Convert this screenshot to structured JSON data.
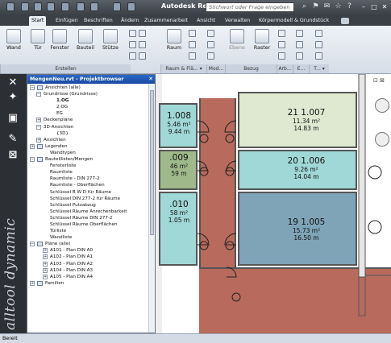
{
  "titlebar": {
    "app_title": "Autodesk Revit A...",
    "search_placeholder": "Stichwort oder Frage eingeben"
  },
  "tabs": [
    {
      "label": "Start",
      "active": true
    },
    {
      "label": "Einfügen"
    },
    {
      "label": "Beschriften"
    },
    {
      "label": "Ändern"
    },
    {
      "label": "Zusammenarbeit"
    },
    {
      "label": "Ansicht"
    },
    {
      "label": "Verwalten"
    },
    {
      "label": "Körpermodell & Grundstück"
    }
  ],
  "ribbon": {
    "buttons": [
      "Wand",
      "Tür",
      "Fenster",
      "Bauteil",
      "Stütze",
      "Raum",
      "Ebene",
      "Raster"
    ],
    "panels": [
      "Erstellen",
      "Raum & Flä... ▾",
      "Mod...",
      "Bezug",
      "Arb...",
      "E...",
      "T... ▾"
    ]
  },
  "browser": {
    "title": "MengenNeu.rvt - Projektbrowser",
    "close": "✕",
    "tree": [
      {
        "label": "Ansichten (alle)",
        "indent": 0,
        "exp": "−",
        "icon": "sq"
      },
      {
        "label": "Grundrisse (Grundrisse)",
        "indent": 1,
        "exp": "−"
      },
      {
        "label": "1.OG",
        "indent": 3,
        "bold": true
      },
      {
        "label": "2.OG",
        "indent": 3
      },
      {
        "label": "EG",
        "indent": 3
      },
      {
        "label": "Deckenpläne",
        "indent": 1,
        "exp": "+"
      },
      {
        "label": "3D-Ansichten",
        "indent": 1,
        "exp": "−"
      },
      {
        "label": "{3D}",
        "indent": 3
      },
      {
        "label": "Ansichten",
        "indent": 1,
        "exp": "+"
      },
      {
        "label": "Legenden",
        "indent": 0,
        "exp": "+",
        "icon": "sq"
      },
      {
        "label": "Wandtypen",
        "indent": 2
      },
      {
        "label": "Bauteillisten/Mengen",
        "indent": 0,
        "exp": "−",
        "icon": "sq"
      },
      {
        "label": "Fensterliste",
        "indent": 2
      },
      {
        "label": "Raumliste",
        "indent": 2
      },
      {
        "label": "Raumliste - DIN 277-2",
        "indent": 2
      },
      {
        "label": "Raumliste - Oberflächen",
        "indent": 2
      },
      {
        "label": "Schlüssel B W D für Räume",
        "indent": 2
      },
      {
        "label": "Schlüssel DIN 277-2 für Räume",
        "indent": 2
      },
      {
        "label": "Schlüssel Putzabzug",
        "indent": 2
      },
      {
        "label": "Schlüssel Räume Anrechenbarkeit",
        "indent": 2
      },
      {
        "label": "Schlüssel Räume DIN 277-2",
        "indent": 2
      },
      {
        "label": "Schlüssel Räume Oberflächen",
        "indent": 2
      },
      {
        "label": "Türliste",
        "indent": 2
      },
      {
        "label": "Wandliste",
        "indent": 2
      },
      {
        "label": "Pläne (alle)",
        "indent": 0,
        "exp": "−",
        "icon": "sq"
      },
      {
        "label": "A101 - Plan DIN A0",
        "indent": 2,
        "exp": "+"
      },
      {
        "label": "A102 - Plan DIN A1",
        "indent": 2,
        "exp": "+"
      },
      {
        "label": "A103 - Plan DIN A2",
        "indent": 2,
        "exp": "+"
      },
      {
        "label": "A104 - Plan DIN A3",
        "indent": 2,
        "exp": "+"
      },
      {
        "label": "A105 - Plan DIN A4",
        "indent": 2,
        "exp": "+"
      },
      {
        "label": "Familien",
        "indent": 0,
        "exp": "+",
        "icon": "sq"
      }
    ]
  },
  "rooms": [
    {
      "name": "21 1.007",
      "area": "11.34 m²",
      "perimeter": "14.83 m",
      "color": "#dfe9d2"
    },
    {
      "name": "20 1.006",
      "area": "9.26 m²",
      "perimeter": "14.04 m",
      "color": "#9fd8d6"
    },
    {
      "name": "19 1.005",
      "area": "15.73 m²",
      "perimeter": "16.50 m",
      "color": "#7fa4b8"
    },
    {
      "name": "1.008",
      "area": "5.46 m²",
      "perimeter": "9.44 m",
      "color": "#9fd8d6"
    },
    {
      "name": ".009",
      "area": "46 m²",
      "perimeter": "59 m",
      "color": "#9fb98b"
    },
    {
      "name": ".010",
      "area": "58 m²",
      "perimeter": "1.05 m",
      "color": "#9fd8d6"
    }
  ],
  "colors": {
    "corridor": "#b86a5c",
    "wall": "#e3e3e3"
  },
  "status": "Bereit",
  "brand": "alltool dynamic"
}
